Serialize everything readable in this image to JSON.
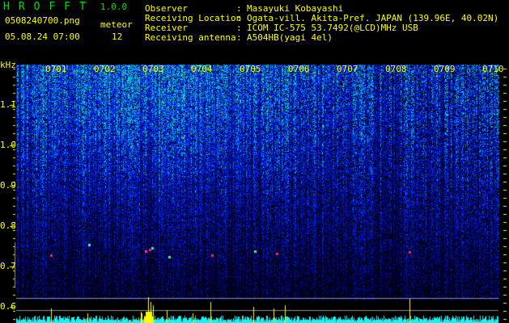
{
  "header": {
    "app_title": "HROFFT",
    "version": "1.0.0",
    "filename": "0508240700.png",
    "datetime": "05.08.24 07:00",
    "meteor_label": "meteor",
    "meteor_count": "12"
  },
  "info": [
    {
      "label": "Observer",
      "value": "Masayuki Kobayashi"
    },
    {
      "label": "Receiving Location",
      "value": "Ogata-vill. Akita-Pref. JAPAN (139.96E, 40.02N)"
    },
    {
      "label": "Receiver",
      "value": "ICOM IC-575 53.7492(@LCD)MHz USB"
    },
    {
      "label": "Receiving antenna",
      "value": "A504HB(yagi 4el)"
    }
  ],
  "axis": {
    "unit": "kHz",
    "freq_labels": [
      "1.1",
      "1.0",
      "0.9",
      "0.8",
      "0.7",
      "0.6"
    ],
    "time_labels": [
      "0701",
      "0702",
      "0703",
      "0704",
      "0705",
      "0706",
      "0707",
      "0708",
      "0709",
      "0710"
    ]
  },
  "colors": {
    "text": "#ffff00",
    "title": "#00e000",
    "histogram": "#00ffff",
    "spike": "#ffff00"
  }
}
